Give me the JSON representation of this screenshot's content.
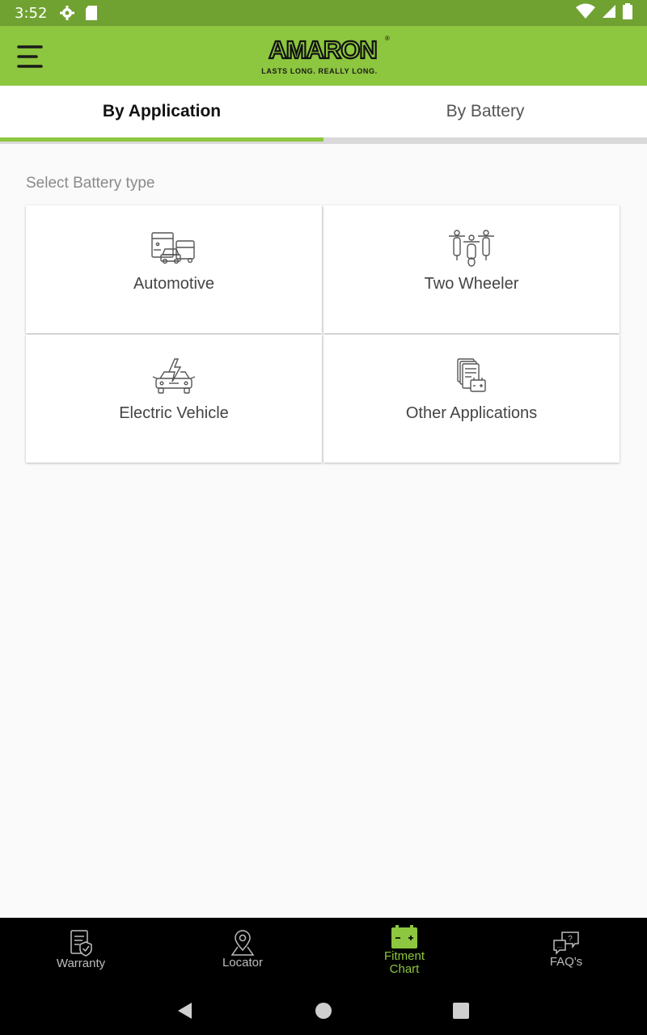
{
  "status_bar": {
    "time": "3:52",
    "left_icons": [
      "gear-icon",
      "sd-card-icon"
    ],
    "right_icons": [
      "wifi-icon",
      "signal-icon",
      "battery-icon"
    ]
  },
  "app_bar": {
    "logo_text": "AMARON",
    "logo_tagline": "LASTS LONG. REALLY LONG.",
    "registered_mark": "®",
    "menu_icon": "hamburger-menu-icon",
    "color": "#8dc63f"
  },
  "tabs": [
    {
      "label": "By Application",
      "active": true
    },
    {
      "label": "By Battery",
      "active": false
    }
  ],
  "section_label": "Select Battery type",
  "battery_types": [
    {
      "label": "Automotive",
      "icon": "truck-car-icon"
    },
    {
      "label": "Two Wheeler",
      "icon": "motorcycles-icon"
    },
    {
      "label": "Electric Vehicle",
      "icon": "electric-car-icon"
    },
    {
      "label": "Other Applications",
      "icon": "documents-battery-icon"
    }
  ],
  "bottom_nav": [
    {
      "label_line1": "Warranty",
      "label_line2": "",
      "icon": "warranty-certificate-icon",
      "active": false
    },
    {
      "label_line1": "Locator",
      "label_line2": "",
      "icon": "location-pin-icon",
      "active": false
    },
    {
      "label_line1": "Fitment",
      "label_line2": "Chart",
      "icon": "battery-icon",
      "active": true
    },
    {
      "label_line1": "FAQ's",
      "label_line2": "",
      "icon": "faq-chat-icon",
      "active": false
    }
  ],
  "system_nav": [
    "back-icon",
    "home-icon",
    "recents-icon"
  ],
  "colors": {
    "accent": "#8dc63f",
    "status_bar": "#70a232",
    "nav_bg": "#000000"
  }
}
